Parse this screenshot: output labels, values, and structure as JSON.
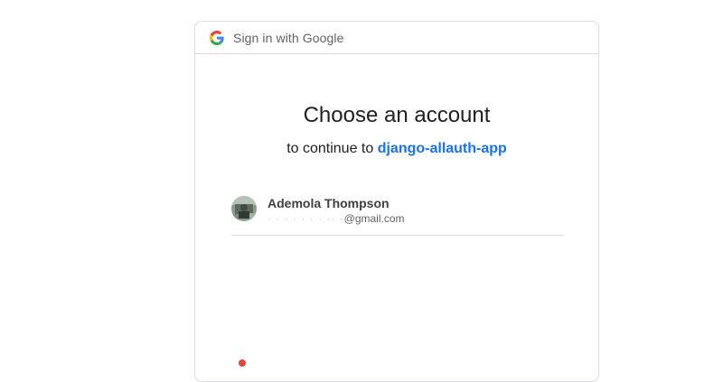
{
  "header": {
    "title": "Sign in with Google",
    "logo_icon": "google-g-icon"
  },
  "main": {
    "title": "Choose an account",
    "subtitle_prefix": "to continue to ",
    "app_name": "django-allauth-app",
    "accounts": [
      {
        "name": "Ademola Thompson",
        "email_hidden": "· ·   · · ·  ·  ·   ·· ·",
        "email_visible": "@gmail.com",
        "avatar_icon": "user-avatar"
      }
    ]
  },
  "colors": {
    "link": "#1a73e8",
    "border": "#dadce0",
    "text": "#202124"
  }
}
